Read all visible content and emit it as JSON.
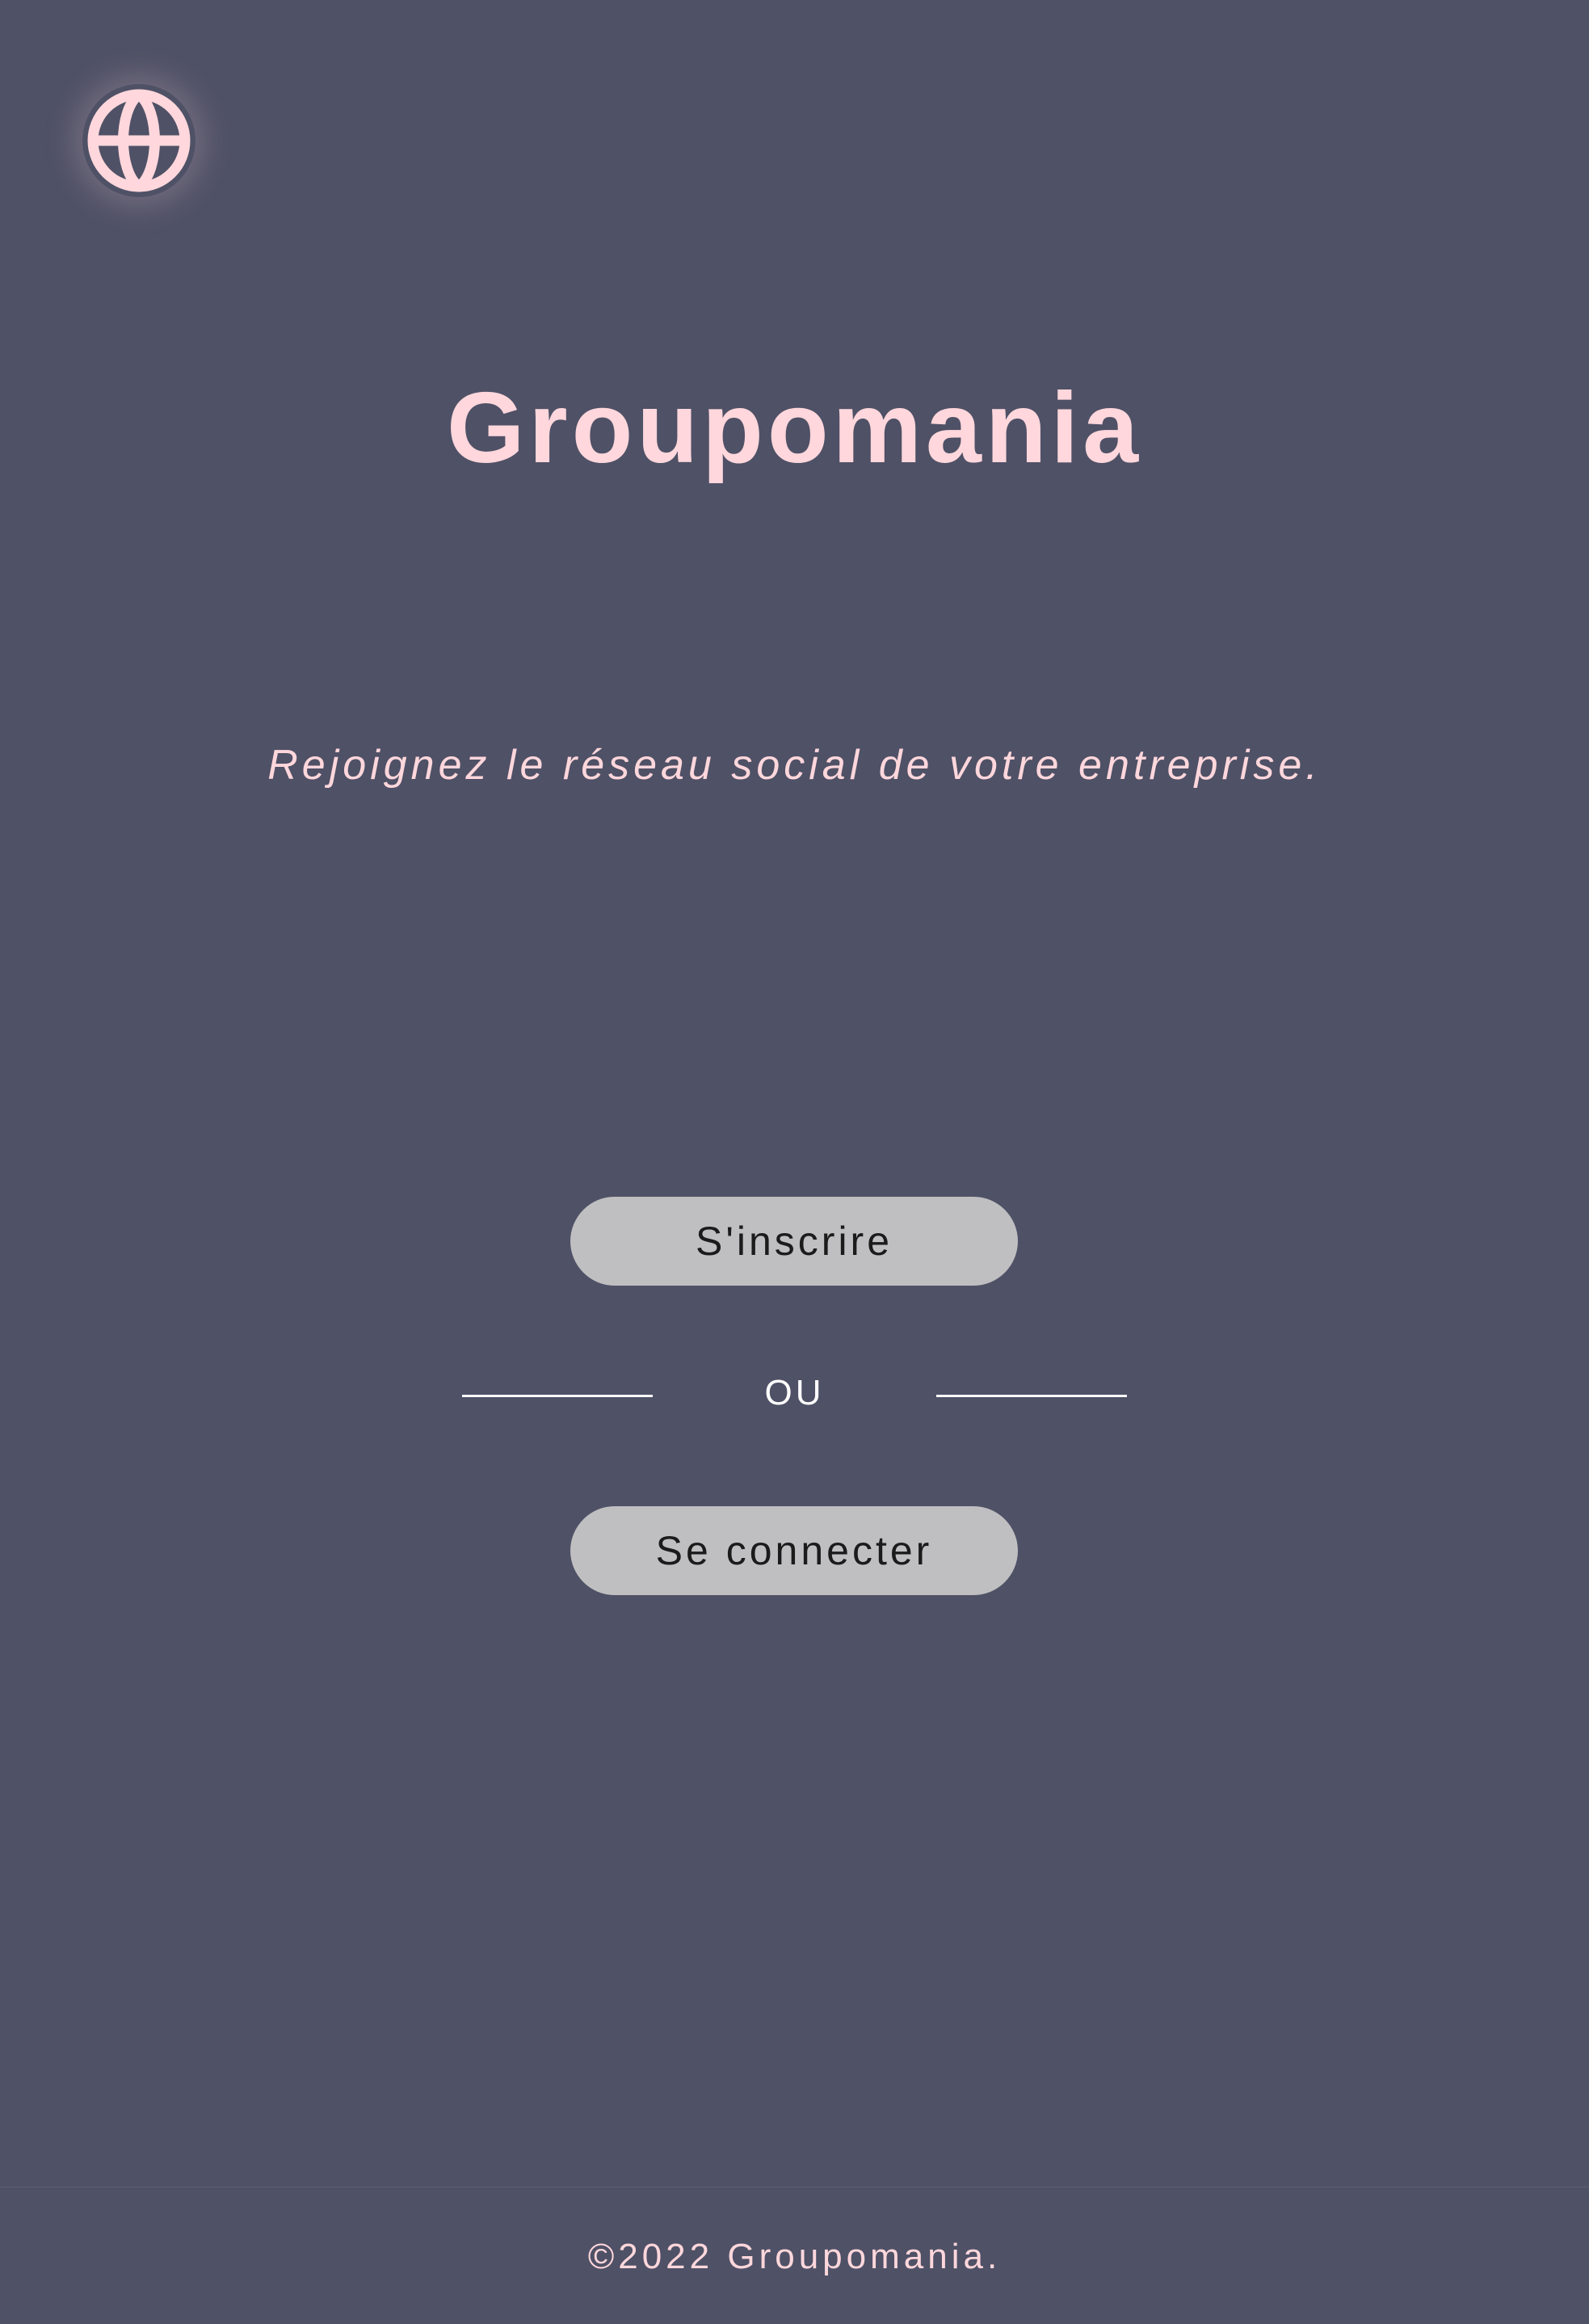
{
  "app": {
    "logo_icon": "globe-icon",
    "accent_color": "#ffd7dc",
    "background_color": "#4f5166"
  },
  "hero": {
    "title": "Groupomania",
    "tagline": "Rejoignez le réseau social de votre entreprise."
  },
  "actions": {
    "signup_label": "S'inscrire",
    "separator_label": "OU",
    "login_label": "Se connecter",
    "button_color": "#bfbfc1"
  },
  "footer": {
    "copyright": "©2022 Groupomania."
  }
}
